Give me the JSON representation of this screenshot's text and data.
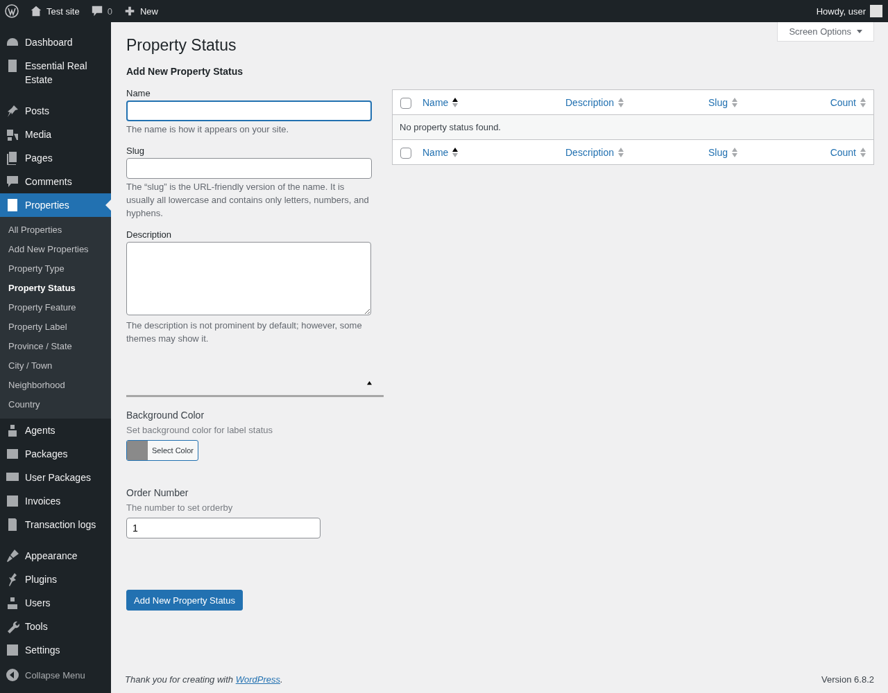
{
  "admin_bar": {
    "site": "Test site",
    "comments": "0",
    "new": "New",
    "greeting": "Howdy, user"
  },
  "sidebar": {
    "groups": [
      [
        {
          "label": "Dashboard",
          "selected": false
        },
        {
          "label": "Essential Real Estate",
          "selected": false
        }
      ],
      [
        {
          "label": "Posts",
          "selected": false
        },
        {
          "label": "Media",
          "selected": false
        },
        {
          "label": "Pages",
          "selected": false
        },
        {
          "label": "Comments",
          "selected": false
        },
        {
          "label": "Properties",
          "selected": true,
          "children": [
            {
              "label": "All Properties",
              "selected": false
            },
            {
              "label": "Add New Properties",
              "selected": false
            },
            {
              "label": "Property Type",
              "selected": false
            },
            {
              "label": "Property Status",
              "selected": true
            },
            {
              "label": "Property Feature",
              "selected": false
            },
            {
              "label": "Property Label",
              "selected": false
            },
            {
              "label": "Province / State",
              "selected": false
            },
            {
              "label": "City / Town",
              "selected": false
            },
            {
              "label": "Neighborhood",
              "selected": false
            },
            {
              "label": "Country",
              "selected": false
            }
          ]
        },
        {
          "label": "Agents",
          "selected": false
        },
        {
          "label": "Packages",
          "selected": false
        },
        {
          "label": "User Packages",
          "selected": false
        },
        {
          "label": "Invoices",
          "selected": false
        },
        {
          "label": "Transaction logs",
          "selected": false
        }
      ],
      [
        {
          "label": "Appearance",
          "selected": false
        },
        {
          "label": "Plugins",
          "selected": false
        },
        {
          "label": "Users",
          "selected": false
        },
        {
          "label": "Tools",
          "selected": false
        },
        {
          "label": "Settings",
          "selected": false
        }
      ]
    ],
    "collapse": "Collapse Menu"
  },
  "screen_options": "Screen Options",
  "page_title": "Property Status",
  "form": {
    "heading": "Add New Property Status",
    "fields": [
      {
        "kind": "text",
        "label": "Name",
        "focused": true,
        "help": "The name is how it appears on your site."
      },
      {
        "kind": "text",
        "label": "Slug",
        "focused": false,
        "help": "The “slug” is the URL-friendly version of the name. It is usually all lowercase and contains only letters, numbers, and hyphens."
      },
      {
        "kind": "textarea",
        "label": "Description",
        "focused": false,
        "help": "The description is not prominent by default; however, some themes may show it."
      },
      {
        "kind": "toggle",
        "expanded": true
      },
      {
        "kind": "color",
        "label": "Background Color",
        "help": "Set background color for label status",
        "color": "#8a8a8a",
        "button": "Select Color"
      },
      {
        "kind": "number",
        "label": "Order Number",
        "help": "The number to set orderby",
        "value": "1",
        "focused": false
      }
    ],
    "submit": "Add New Property Status"
  },
  "table": {
    "columns": [
      {
        "label": "Name",
        "sorted": true
      },
      {
        "label": "Description",
        "sorted": false
      },
      {
        "label": "Slug",
        "sorted": false
      },
      {
        "label": "Count",
        "sorted": false
      }
    ],
    "select_all_checked": false,
    "empty": "No property status found.",
    "footer_select_all_checked": false,
    "footer_columns": [
      {
        "label": "Name",
        "sorted": true
      },
      {
        "label": "Description",
        "sorted": false
      },
      {
        "label": "Slug",
        "sorted": false
      },
      {
        "label": "Count",
        "sorted": false
      }
    ]
  },
  "footer": {
    "before": "Thank you for creating with ",
    "link": "WordPress",
    "after": ".",
    "version": "Version 6.8.2"
  }
}
